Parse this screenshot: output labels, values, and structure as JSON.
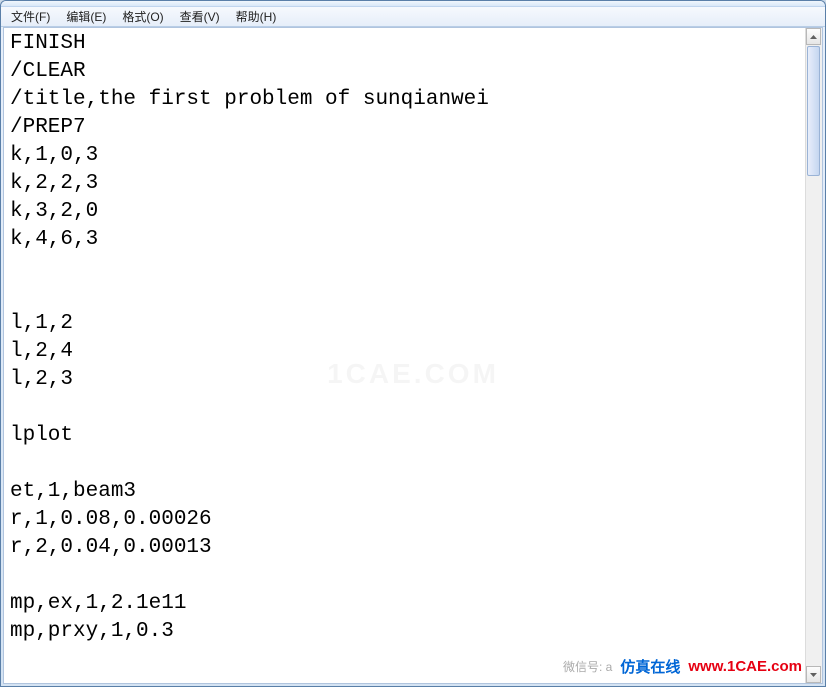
{
  "menubar": {
    "items": [
      {
        "label": "文件(F)"
      },
      {
        "label": "编辑(E)"
      },
      {
        "label": "格式(O)"
      },
      {
        "label": "查看(V)"
      },
      {
        "label": "帮助(H)"
      }
    ]
  },
  "editor": {
    "content": "FINISH\n/CLEAR\n/title,the first problem of sunqianwei\n/PREP7\nk,1,0,3\nk,2,2,3\nk,3,2,0\nk,4,6,3\n\n\nl,1,2\nl,2,4\nl,2,3\n\nlplot\n\net,1,beam3\nr,1,0.08,0.00026\nr,2,0.04,0.00013\n\nmp,ex,1,2.1e11\nmp,prxy,1,0.3"
  },
  "watermarks": {
    "center": "1CAE.COM",
    "bottomRight": {
      "prefix": "微信号: a",
      "blue": "仿真在线",
      "red": "www.1CAE.com"
    }
  }
}
